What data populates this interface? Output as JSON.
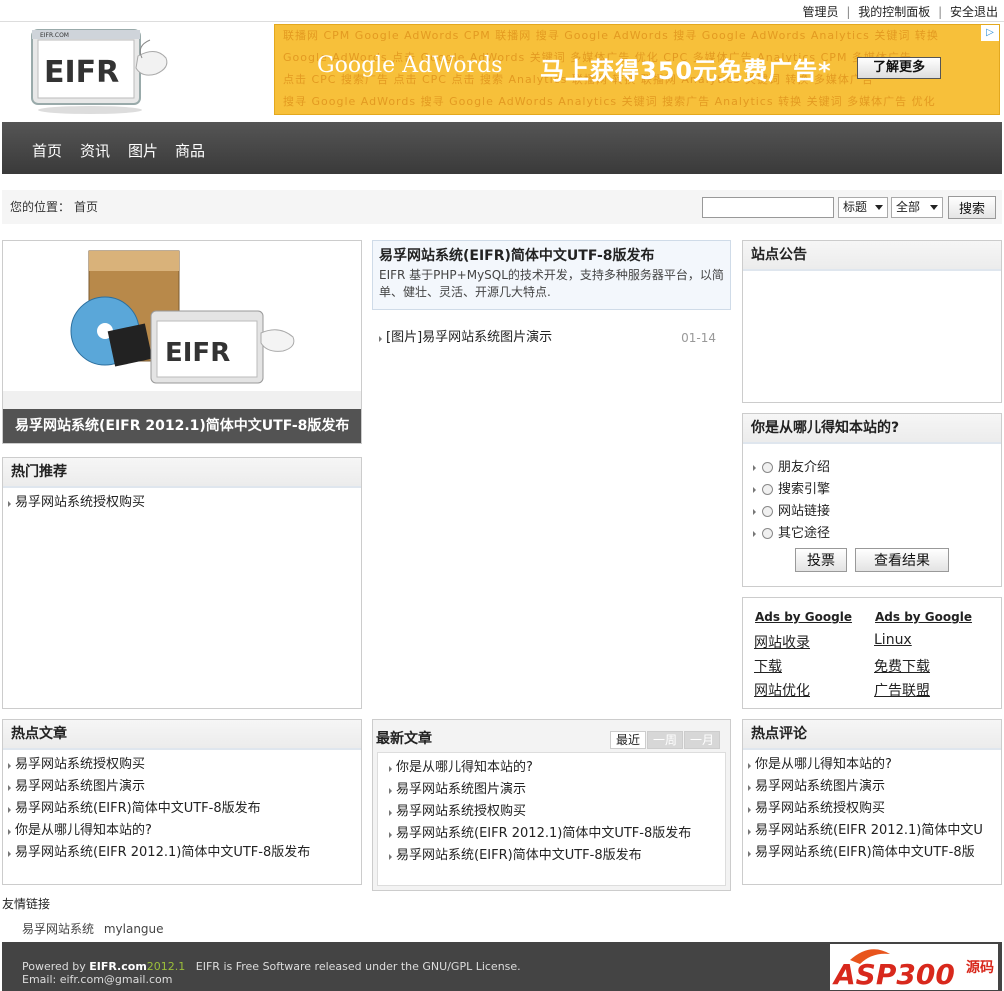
{
  "topbar": {
    "admin": "管理员",
    "panel": "我的控制面板",
    "logout": "安全退出",
    "sep": "|"
  },
  "logo": {
    "text": "EIFR",
    "small": "EIFR.COM"
  },
  "ad": {
    "google": "Google AdWords",
    "promo": "马上获得350元免费广告*",
    "more": "了解更多",
    "bg_rows": [
      "联播网 CPM Google AdWords CPM 联播网 搜寻 Google AdWords 搜寻 Google AdWords Analytics 关键词 转换",
      "Google AdWords 点击 Google AdWords 关键词 多媒体广告 优化 CPC 多媒体广告 Analytics CPM 多媒体广告",
      "点击 CPC 搜索广告 点击 CPC 点击 搜索 Analytics 联播网 转换 联播网 Analytics 关键词 转换 多媒体广告",
      "搜寻 Google AdWords 搜寻 Google AdWords Analytics 关键词 搜索广告 Analytics 转换 关键词 多媒体广告 优化"
    ]
  },
  "nav": [
    "首页",
    "资讯",
    "图片",
    "商品"
  ],
  "crumb": {
    "label": "您的位置：",
    "home": "首页"
  },
  "search": {
    "placeholder": "",
    "field": "标题",
    "scope": "全部",
    "button": "搜索"
  },
  "slide": {
    "caption": "易孚网站系统(EIFR 2012.1)简体中文UTF-8版发布"
  },
  "headline": {
    "title": "易孚网站系统(EIFR)简体中文UTF-8版发布",
    "desc": "EIFR 基于PHP+MySQL的技术开发，支持多种服务器平台，以简单、健壮、灵活、开源几大特点."
  },
  "center_item": {
    "text": "[图片]易孚网站系统图片演示",
    "date": "01-14"
  },
  "notice": {
    "title": "站点公告"
  },
  "hot_rec": {
    "title": "热门推荐",
    "items": [
      "易孚网站系统授权购买"
    ]
  },
  "poll": {
    "title": "你是从哪儿得知本站的?",
    "options": [
      "朋友介绍",
      "搜索引擎",
      "网站链接",
      "其它途径"
    ],
    "vote": "投票",
    "result": "查看结果"
  },
  "ads_google": {
    "head1": "Ads by Google",
    "head2": "Ads by Google",
    "col1": [
      "网站收录",
      "下载",
      "网站优化"
    ],
    "col2": [
      "Linux",
      "免费下载",
      "广告联盟"
    ]
  },
  "hot_articles": {
    "title": "热点文章",
    "items": [
      "易孚网站系统授权购买",
      "易孚网站系统图片演示",
      "易孚网站系统(EIFR)简体中文UTF-8版发布",
      "你是从哪儿得知本站的?",
      "易孚网站系统(EIFR 2012.1)简体中文UTF-8版发布"
    ]
  },
  "latest": {
    "title": "最新文章",
    "tabs": [
      "最近",
      "一周",
      "一月"
    ],
    "items": [
      "你是从哪儿得知本站的?",
      "易孚网站系统图片演示",
      "易孚网站系统授权购买",
      "易孚网站系统(EIFR 2012.1)简体中文UTF-8版发布",
      "易孚网站系统(EIFR)简体中文UTF-8版发布"
    ]
  },
  "hot_comments": {
    "title": "热点评论",
    "items": [
      "你是从哪儿得知本站的?",
      "易孚网站系统图片演示",
      "易孚网站系统授权购买",
      "易孚网站系统(EIFR 2012.1)简体中文U",
      "易孚网站系统(EIFR)简体中文UTF-8版"
    ]
  },
  "friends": {
    "title": "友情链接",
    "links": [
      "易孚网站系统",
      "mylangue"
    ]
  },
  "footer": {
    "powered": "Powered by",
    "brand": "EIFR.com",
    "year": "2012.1",
    "license": "EIFR is Free Software released under the GNU/GPL License.",
    "email": "Email: eifr.com@gmail.com",
    "badge": "ASP300",
    "badge_cn": "源码"
  }
}
